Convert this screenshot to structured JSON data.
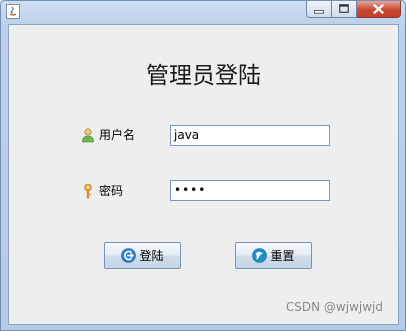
{
  "window": {
    "title": "",
    "buttons": {
      "minimize": "minimize",
      "maximize": "maximize",
      "close": "close"
    }
  },
  "form": {
    "title": "管理员登陆",
    "username": {
      "label": "用户名",
      "value": "java",
      "icon": "user-icon"
    },
    "password": {
      "label": "密码",
      "value": "••••",
      "icon": "key-icon"
    }
  },
  "actions": {
    "login_label": "登陆",
    "login_icon": "login-arrow-icon",
    "reset_label": "重置",
    "reset_icon": "reset-icon"
  },
  "watermark": "CSDN @wjwjwjd",
  "colors": {
    "titlebar": "#bcd1eb",
    "content": "#eeeeee",
    "close_button": "#c94a36"
  }
}
